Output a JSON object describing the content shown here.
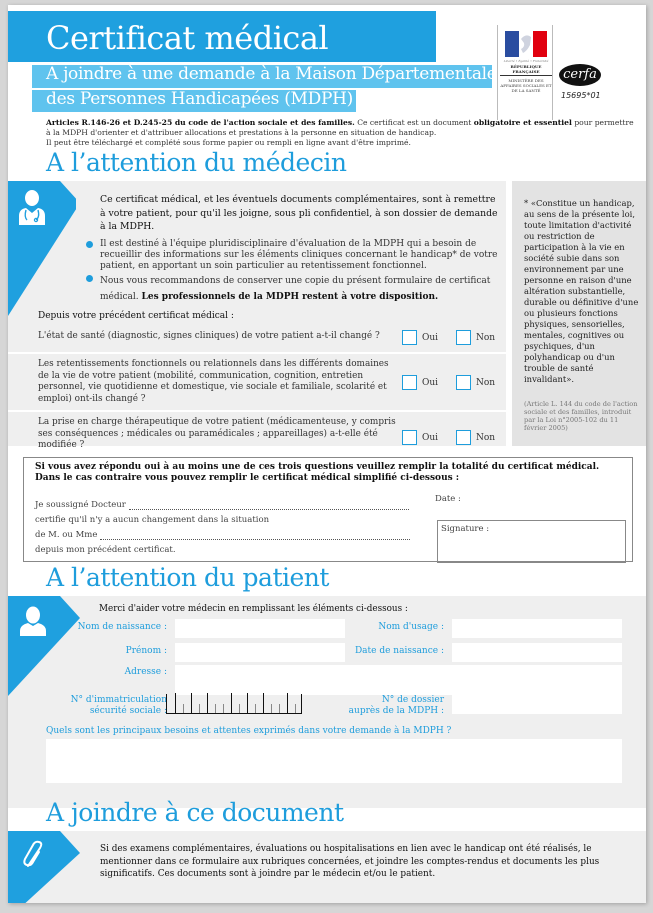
{
  "header": {
    "title": "Certificat médical",
    "subtitle_line1": "A joindre à une demande à la Maison Départementale",
    "subtitle_line2": "des Personnes Handicapées (MDPH)",
    "logo": {
      "motto": "Liberté • Égalité • Fraternité",
      "republic": "RÉPUBLIQUE FRANÇAISE",
      "ministry": "MINISTÈRE DES AFFAIRES SOCIALES ET DE LA SANTÉ",
      "flag_colors": [
        "#2a4da0",
        "#ffffff",
        "#e1000f"
      ]
    },
    "cerfa_label": "cerfa",
    "cerfa_number": "15695*01",
    "intro_bold": "Articles R.146-26 et D.245-25 du code de l'action sociale et des familles.",
    "intro_1": " Ce certificat est un document ",
    "intro_bold2": "obligatoire et essentiel",
    "intro_2": " pour permettre à la MDPH d'orienter et d'attribuer allocations et prestations à la personne en situation de handicap.",
    "intro_3": "Il peut être téléchargé et complété sous forme papier ou rempli en ligne avant d'être imprimé."
  },
  "doctor_section": {
    "title": "A l’attention du médecin",
    "icon": "doctor-icon",
    "intro": "Ce certificat médical, et les éventuels documents complémentaires, sont à remettre à votre patient, pour qu'il les joigne, sous pli confidentiel, à son dossier de demande à la MDPH.",
    "bullet1": "Il est destiné à l'équipe pluridisciplinaire d'évaluation de la MDPH qui a besoin de recueillir des informations sur les éléments cliniques concernant le handicap* de votre patient, en apportant un soin particulier au retentissement fonctionnel.",
    "bullet2_normal": "Nous vous recommandons de conserver une copie du présent formulaire de certificat médical. ",
    "bullet2_bold": "Les professionnels de la MDPH restent à votre disposition.",
    "questions_heading": "Depuis votre précédent certificat médical :",
    "questions": [
      {
        "text": "L'état de santé (diagnostic, signes cliniques) de votre patient a-t-il changé ?",
        "yes_label": "Oui",
        "no_label": "Non",
        "yes_checked": false,
        "no_checked": false
      },
      {
        "text": "Les retentissements fonctionnels ou relationnels dans les différents domaines de la vie de votre patient (mobilité, communication, cognition, entretien personnel, vie quotidienne et domestique, vie sociale et familiale, scolarité et emploi) ont-ils changé ?",
        "yes_label": "Oui",
        "no_label": "Non",
        "yes_checked": false,
        "no_checked": false
      },
      {
        "text": "La prise en charge thérapeutique de votre patient (médicamenteuse, y compris ses conséquences ; médicales ou paramédicales ; appareillages) a-t-elle été modifiée ?",
        "yes_label": "Oui",
        "no_label": "Non",
        "yes_checked": false,
        "no_checked": false
      }
    ],
    "sidebar_quote": "* «Constitue un handicap, au sens de la présente loi, toute limitation d'activité ou restriction de participation à la vie en société subie dans son environnement par une personne en raison d'une altération substantielle, durable ou définitive d'une ou plusieurs fonctions physiques, sensorielles, mentales, cognitives ou psychiques, d'un polyhandicap ou d'un trouble de santé invalidant».",
    "sidebar_ref": "(Article L. 144 du code de l'action sociale et des familles, introduit par la Loi n°2005-102 du 11 février 2005)"
  },
  "simplified": {
    "heading_line1": "Si vous avez répondu oui à au moins une de ces trois questions veuillez remplir la totalité du certificat médical.",
    "heading_line2": "Dans le cas contraire vous pouvez remplir le certificat médical simplifié ci-dessous :",
    "line1": "Je soussigné Docteur",
    "line2": "certifie qu'il n'y a aucun changement dans la situation",
    "line3": "de M. ou Mme",
    "line4": "depuis mon précédent certificat.",
    "date_label": "Date :",
    "signature_label": "Signature :"
  },
  "patient_section": {
    "title": "A l’attention du patient",
    "icon": "person-icon",
    "intro": "Merci d'aider votre médecin en remplissant les éléments ci-dessous :",
    "fields": {
      "birth_name": {
        "label": "Nom de naissance :",
        "value": ""
      },
      "usage_name": {
        "label": "Nom d'usage :",
        "value": ""
      },
      "first_name": {
        "label": "Prénom :",
        "value": ""
      },
      "birth_date": {
        "label": "Date de naissance :",
        "value": ""
      },
      "address": {
        "label": "Adresse :",
        "value": ""
      },
      "ss_number_line1": "N° d'immatriculation",
      "ss_number_line2": "sécurité sociale :",
      "ss_number_value": "",
      "file_number_line1": "N° de dossier",
      "file_number_line2": "auprès de la MDPH :",
      "file_number_value": ""
    },
    "needs_label": "Quels sont les principaux besoins et attentes exprimés dans votre demande à la MDPH ?",
    "needs_value": ""
  },
  "attach_section": {
    "title": "A joindre à ce document",
    "icon": "paperclip-icon",
    "text": "Si des examens complémentaires, évaluations ou hospitalisations en lien avec le handicap ont été réalisés, le mentionner dans ce formulaire aux rubriques concernées, et joindre les comptes-rendus et documents les plus significatifs. Ces documents sont à joindre par le médecin et/ou le patient."
  },
  "colors": {
    "accent": "#1fa0df",
    "accent_light": "#5fc3ee",
    "panel": "#efefef",
    "sidebar": "#e3e3e3"
  }
}
